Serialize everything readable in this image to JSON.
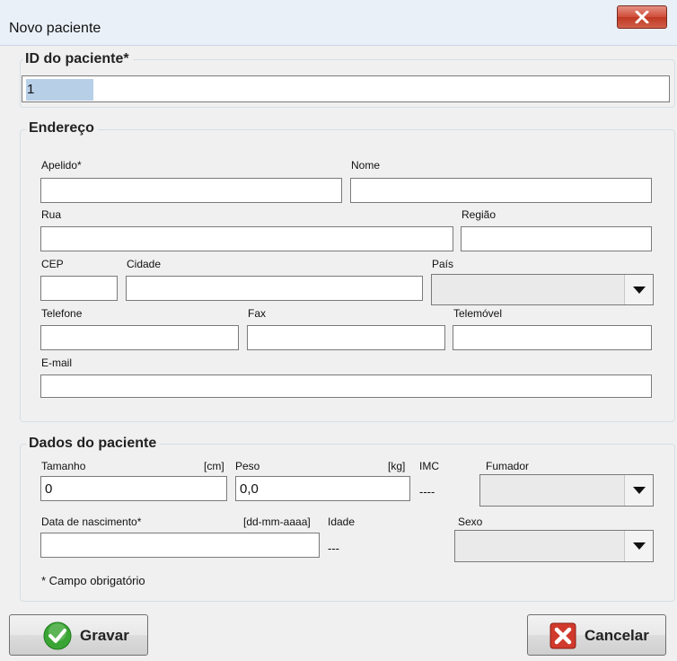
{
  "window": {
    "title": "Novo paciente"
  },
  "patient_id": {
    "legend": "ID do paciente*",
    "value": "1"
  },
  "address": {
    "legend": "Endereço",
    "apelido_label": "Apelido*",
    "nome_label": "Nome",
    "rua_label": "Rua",
    "regiao_label": "Região",
    "cep_label": "CEP",
    "cidade_label": "Cidade",
    "pais_label": "País",
    "telefone_label": "Telefone",
    "fax_label": "Fax",
    "telemovel_label": "Telemóvel",
    "email_label": "E-mail"
  },
  "patient_data": {
    "legend": "Dados do paciente",
    "tamanho_label": "Tamanho",
    "tamanho_unit": "[cm]",
    "tamanho_value": "0",
    "peso_label": "Peso",
    "peso_unit": "[kg]",
    "peso_value": "0,0",
    "imc_label": "IMC",
    "imc_value": "----",
    "fumador_label": "Fumador",
    "nascimento_label": "Data de nascimento*",
    "nascimento_unit": "[dd-mm-aaaa]",
    "idade_label": "Idade",
    "idade_value": "---",
    "sexo_label": "Sexo",
    "required_note": "* Campo obrigatório"
  },
  "buttons": {
    "save": "Gravar",
    "cancel": "Cancelar"
  },
  "colors": {
    "save_icon": "#3aa534",
    "cancel_icon": "#d03a2c"
  }
}
